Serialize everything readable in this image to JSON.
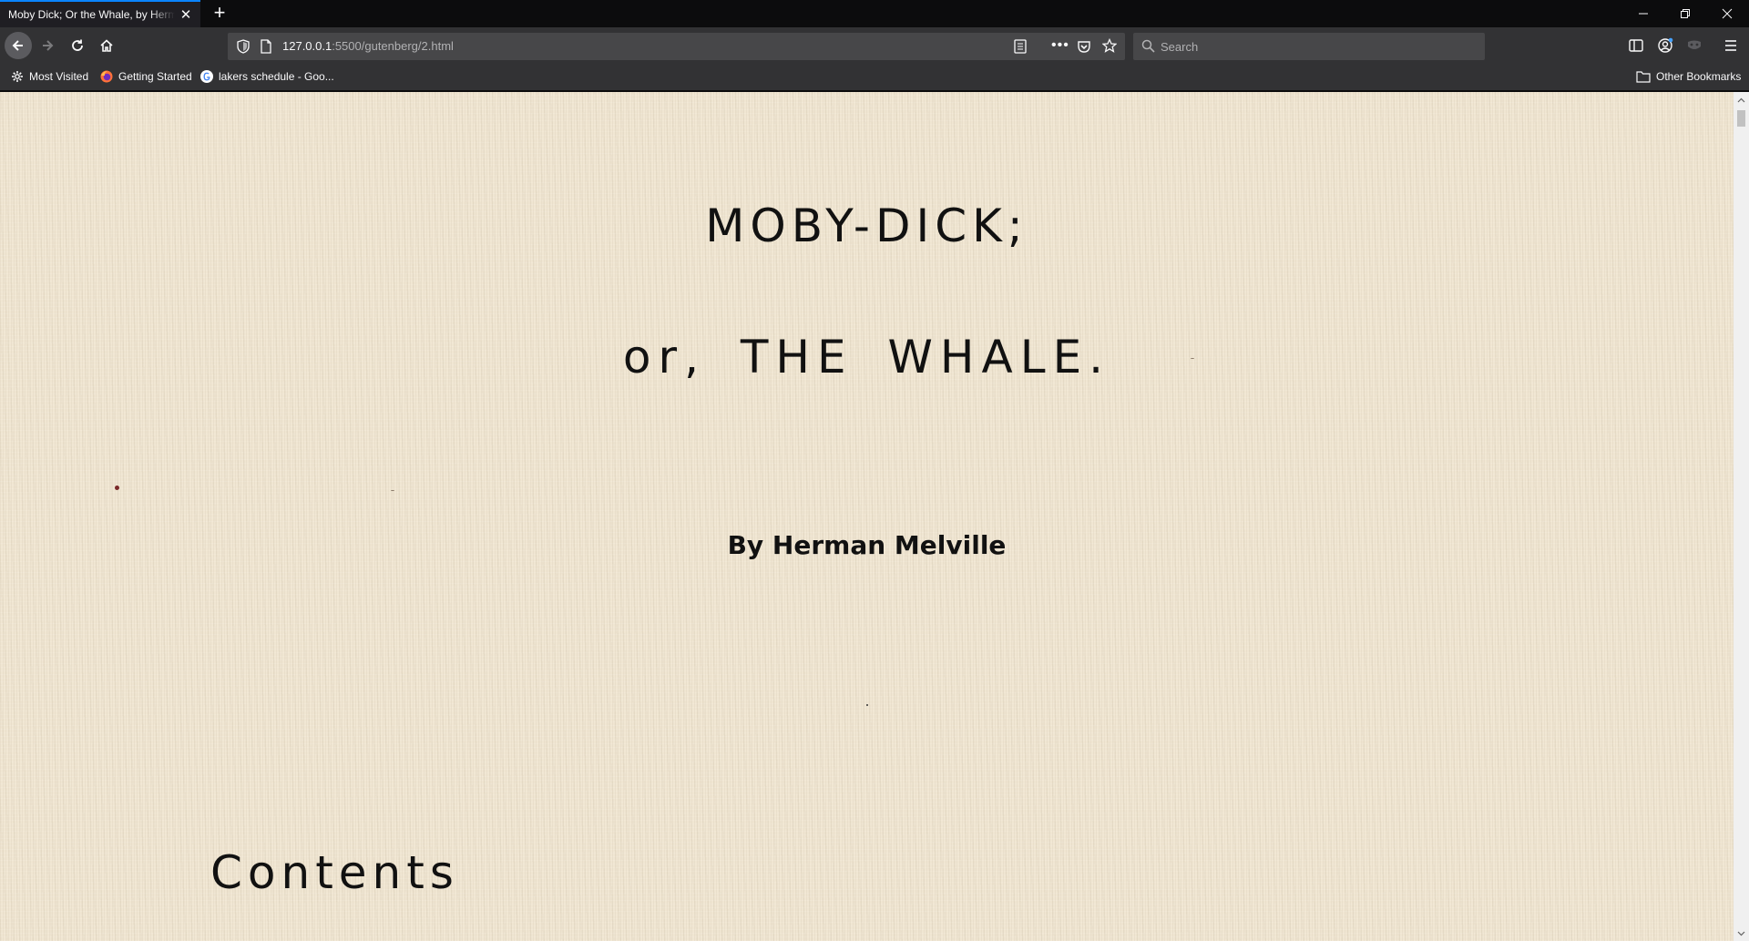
{
  "tab": {
    "title": "Moby Dick; Or the Whale, by Herman Melville"
  },
  "navigation": {
    "url_host": "127.0.0.1",
    "url_rest": ":5500/gutenberg/2.html",
    "search_placeholder": "Search"
  },
  "bookmarks": {
    "items": [
      {
        "label": "Most Visited",
        "icon": "gear-icon"
      },
      {
        "label": "Getting Started",
        "icon": "firefox-icon"
      },
      {
        "label": "lakers schedule - Goo...",
        "icon": "google-icon"
      }
    ],
    "other_label": "Other Bookmarks"
  },
  "page": {
    "title": "MOBY-DICK;",
    "subtitle": "or, THE WHALE.",
    "author": "By Herman Melville",
    "contents_heading": "Contents"
  },
  "colors": {
    "page_background": "#f0e6d2",
    "text": "#111111",
    "chrome_dark": "#0c0c0d",
    "toolbar": "#323234",
    "accent": "#0a84ff"
  }
}
